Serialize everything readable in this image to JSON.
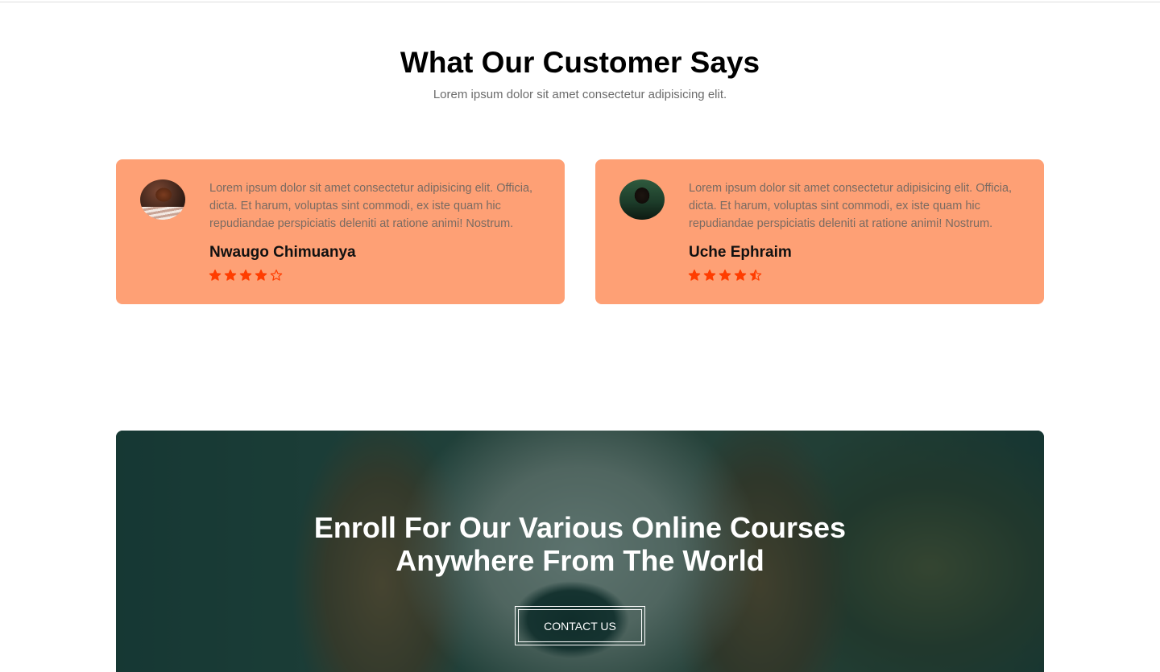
{
  "testimonials_section": {
    "title": "What Our Customer Says",
    "subtitle": "Lorem ipsum dolor sit amet consectetur adipisicing elit.",
    "accent_color": "#fea075",
    "star_color": "#ff3d00",
    "items": [
      {
        "quote": "Lorem ipsum dolor sit amet consectetur adipisicing elit. Officia, dicta. Et harum, voluptas sint commodi, ex iste quam hic repudiandae perspiciatis deleniti at ratione animi! Nostrum.",
        "name": "Nwaugo Chimuanya",
        "rating": 4,
        "avatar_icon": "user-photo-avatar"
      },
      {
        "quote": "Lorem ipsum dolor sit amet consectetur adipisicing elit. Officia, dicta. Et harum, voluptas sint commodi, ex iste quam hic repudiandae perspiciatis deleniti at ratione animi! Nostrum.",
        "name": "Uche Ephraim",
        "rating": 4.5,
        "avatar_icon": "user-photo-avatar"
      }
    ]
  },
  "cta_banner": {
    "title_line1": "Enroll For Our Various Online Courses",
    "title_line2": "Anywhere From The World",
    "button_label": "CONTACT US",
    "overlay_color": "#113734",
    "background_image": "beagle-dog-photo"
  }
}
